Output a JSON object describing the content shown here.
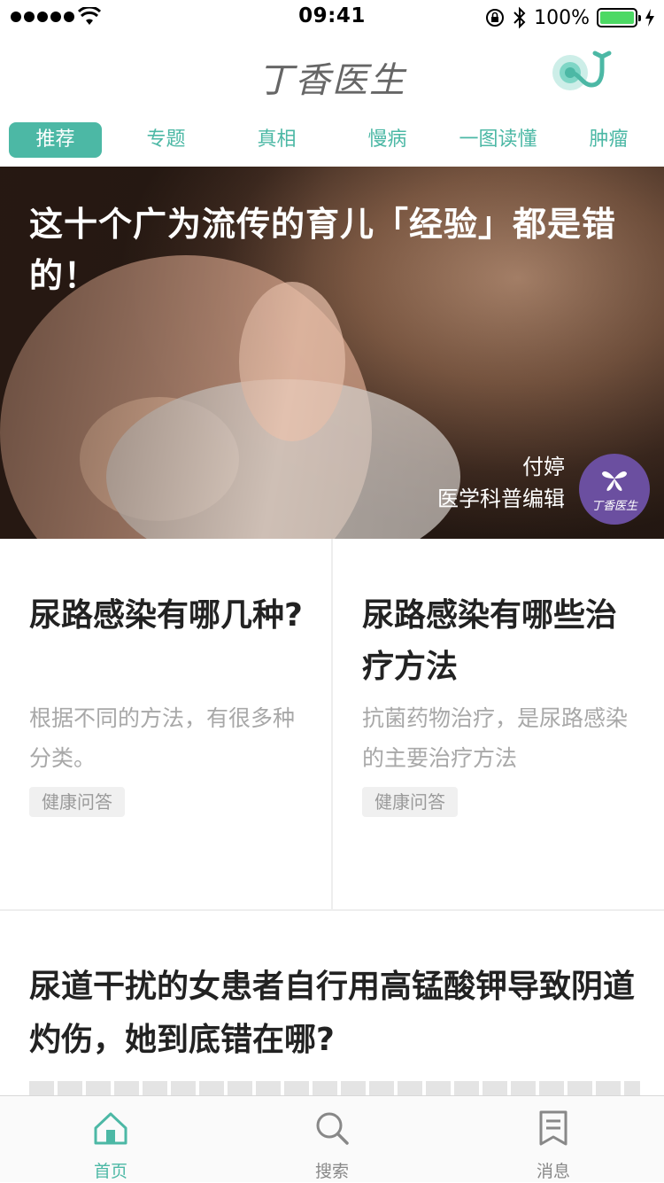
{
  "status_bar": {
    "time": "09:41",
    "battery": "100%",
    "battery_level": 1.0
  },
  "header": {
    "title": "丁香医生"
  },
  "tabs": [
    {
      "label": "推荐",
      "active": true
    },
    {
      "label": "专题",
      "active": false
    },
    {
      "label": "真相",
      "active": false
    },
    {
      "label": "慢病",
      "active": false
    },
    {
      "label": "一图读懂",
      "active": false
    },
    {
      "label": "肿瘤",
      "active": false
    }
  ],
  "hero": {
    "title": "这十个广为流传的育儿「经验」都是错的！",
    "author_name": "付婷",
    "author_role": "医学科普编辑",
    "badge_label": "丁香医生"
  },
  "cards": [
    {
      "title": "尿路感染有哪几种?",
      "description": "根据不同的方法，有很多种分类。",
      "tag": "健康问答"
    },
    {
      "title": "尿路感染有哪些治疗方法",
      "description": "抗菌药物治疗，是尿路感染的主要治疗方法",
      "tag": "健康问答"
    }
  ],
  "article": {
    "title": "尿道干扰的女患者自行用高锰酸钾导致阴道灼伤，她到底错在哪?"
  },
  "bottom_nav": [
    {
      "label": "首页",
      "icon": "home-icon",
      "active": true
    },
    {
      "label": "搜索",
      "icon": "search-icon",
      "active": false
    },
    {
      "label": "消息",
      "icon": "message-icon",
      "active": false
    }
  ],
  "colors": {
    "accent": "#4cb8a5",
    "badge": "#6b4fa0",
    "battery": "#4cd964"
  }
}
